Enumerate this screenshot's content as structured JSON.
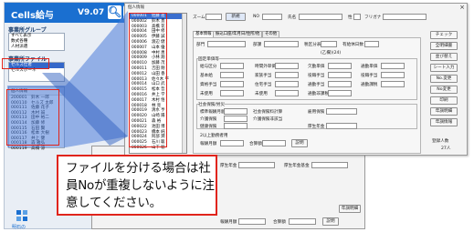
{
  "app": {
    "title": "Cells給与",
    "version": "V9.07",
    "brand_color": "#1a6fd0",
    "logo_text": "明石の"
  },
  "sidebar": {
    "group_header": "事業所グループ",
    "groups": [
      "すべて表示",
      "数式各種",
      "人材派遣"
    ],
    "file_header": "事業所ファイル",
    "files": [
      "セルズ仕者",
      "セルズボーネ"
    ]
  },
  "mini_list": {
    "header": "個人情報",
    "rows": [
      {
        "no": "200001",
        "name": "鈴木 一郎"
      },
      {
        "no": "000110",
        "name": "セルズ 太郎"
      },
      {
        "no": "000111",
        "name": "佐藤 花子"
      },
      {
        "no": "000112",
        "name": "木村 誠"
      },
      {
        "no": "000113",
        "name": "田中 裕二"
      },
      {
        "no": "000114",
        "name": "加藤 修"
      },
      {
        "no": "000115",
        "name": "石田 賢"
      },
      {
        "no": "000116",
        "name": "松本 大樹"
      },
      {
        "no": "000117",
        "name": "井上 健"
      },
      {
        "no": "000118",
        "name": "森 雅弘"
      },
      {
        "no": "000119",
        "name": "高橋 涼"
      }
    ]
  },
  "dialog": {
    "title": "個人情報",
    "zoom_label": "ズーム",
    "new_button": "新規",
    "no_label": "NO",
    "name_label": "氏名",
    "gender_label": "性",
    "kana_label": "フリガナ",
    "tabs": [
      "基本情報",
      "振込口座/年月日/住所/他",
      "その他"
    ],
    "dept_label": "部門",
    "grade_label": "部課",
    "tax_table_label": "税区分表",
    "paid_leave_label": "有給休日数",
    "note_2": "(乙欄)(24)",
    "pay_section": "固定単価等",
    "pay_labels": [
      "給与区分",
      "時間外単価",
      "欠勤単価",
      "通勤単価",
      "基本給",
      "家族手当",
      "役職手当",
      "役職手当",
      "資格手当",
      "住宅手当",
      "通勤手当",
      "通勤課税",
      "未使用",
      "未使用",
      "通勤非課税"
    ],
    "insurance_section": "社会保険/労災",
    "insurance_labels": [
      "標準報酬月額",
      "介護保険",
      "雇用保険"
    ],
    "social_check": "社会保険料計算",
    "care_check": "介護保険非該当",
    "fee_labels": [
      "健康保険",
      "厚生年金"
    ],
    "old_pension_label": "2以上勤務者用",
    "monthly_label": "報酬月額",
    "total_label": "合算額",
    "explain_button": "説明",
    "resident_section": "住民税",
    "resident_labels": [
      "市区町村",
      "住民税年額",
      "住民税明細(日月目別)"
    ],
    "deduction_section": "控除額等",
    "deduction_labels": [
      "積立金",
      "貸付金",
      "未使用",
      "未使用",
      "未使用"
    ],
    "side_buttons": [
      "チェック",
      "全明細書",
      "並び替え",
      "シート入力",
      "No.変更",
      "No変更",
      "印刷",
      "年調明細",
      "年調情報"
    ],
    "reg_count_label": "登録人数",
    "reg_count_value": "27人",
    "employees": [
      {
        "no": "000001",
        "name": "佐藤 進"
      },
      {
        "no": "000002",
        "name": "鈴木 直"
      },
      {
        "no": "000003",
        "name": "高橋 花"
      },
      {
        "no": "000004",
        "name": "田中 修"
      },
      {
        "no": "000005",
        "name": "伊藤 誠"
      },
      {
        "no": "000006",
        "name": "渡辺 健"
      },
      {
        "no": "000007",
        "name": "山本 優"
      },
      {
        "no": "000008",
        "name": "中村 恵"
      },
      {
        "no": "000009",
        "name": "小林 翔"
      },
      {
        "no": "000010",
        "name": "加藤 茂"
      },
      {
        "no": "000011",
        "name": "吉田 剛"
      },
      {
        "no": "000012",
        "name": "山田 香"
      },
      {
        "no": "000013",
        "name": "佐々木 平"
      },
      {
        "no": "000014",
        "name": "山口 武"
      },
      {
        "no": "000015",
        "name": "松本 哲"
      },
      {
        "no": "000016",
        "name": "井上 学"
      },
      {
        "no": "000017",
        "name": "木村 悟"
      },
      {
        "no": "000018",
        "name": "林 亮"
      },
      {
        "no": "000019",
        "name": "清水 亨"
      },
      {
        "no": "000020",
        "name": "山崎 陽"
      },
      {
        "no": "000021",
        "name": "森 裕"
      },
      {
        "no": "000022",
        "name": "池田 博"
      },
      {
        "no": "000023",
        "name": "橋本 純"
      },
      {
        "no": "000024",
        "name": "阿部 潤"
      },
      {
        "no": "000025",
        "name": "石川 聡"
      },
      {
        "no": "000026",
        "name": "山下 稔"
      }
    ]
  },
  "back_sheet": {
    "fee_labels": [
      "厚生年金",
      "厚生年金基金"
    ],
    "monthly_label": "報酬月額",
    "total_label": "合算額",
    "explain_button": "説明",
    "tax_button": "年調明細"
  },
  "callout": {
    "text": "ファイルを分ける場合は社員Noが重複しないように注意してください。",
    "border_color": "#e0241b"
  }
}
